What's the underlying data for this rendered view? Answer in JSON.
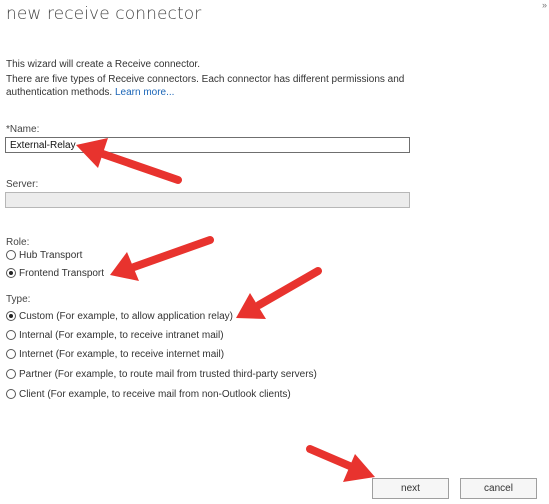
{
  "window": {
    "title": "new receive connector",
    "corner_mark": "»"
  },
  "intro": {
    "line1": "This wizard will create a Receive connector.",
    "line2": "There are five types of Receive connectors. Each connector has different permissions and authentication methods.",
    "learn_more": "Learn more..."
  },
  "name_field": {
    "label": "*Name:",
    "value": "External-Relay"
  },
  "server_field": {
    "label": "Server:",
    "value": ""
  },
  "role": {
    "label": "Role:",
    "options": [
      {
        "label": "Hub Transport",
        "checked": false
      },
      {
        "label": "Frontend Transport",
        "checked": true
      }
    ]
  },
  "type": {
    "label": "Type:",
    "options": [
      {
        "label": "Custom (For example, to allow application relay)",
        "checked": true
      },
      {
        "label": "Internal (For example, to receive intranet mail)",
        "checked": false
      },
      {
        "label": "Internet (For example, to receive internet mail)",
        "checked": false
      },
      {
        "label": "Partner (For example, to route mail from trusted third-party servers)",
        "checked": false
      },
      {
        "label": "Client (For example, to receive mail from non-Outlook clients)",
        "checked": false
      }
    ]
  },
  "buttons": {
    "next": "next",
    "cancel": "cancel"
  },
  "annotation_color": "#e8332e"
}
